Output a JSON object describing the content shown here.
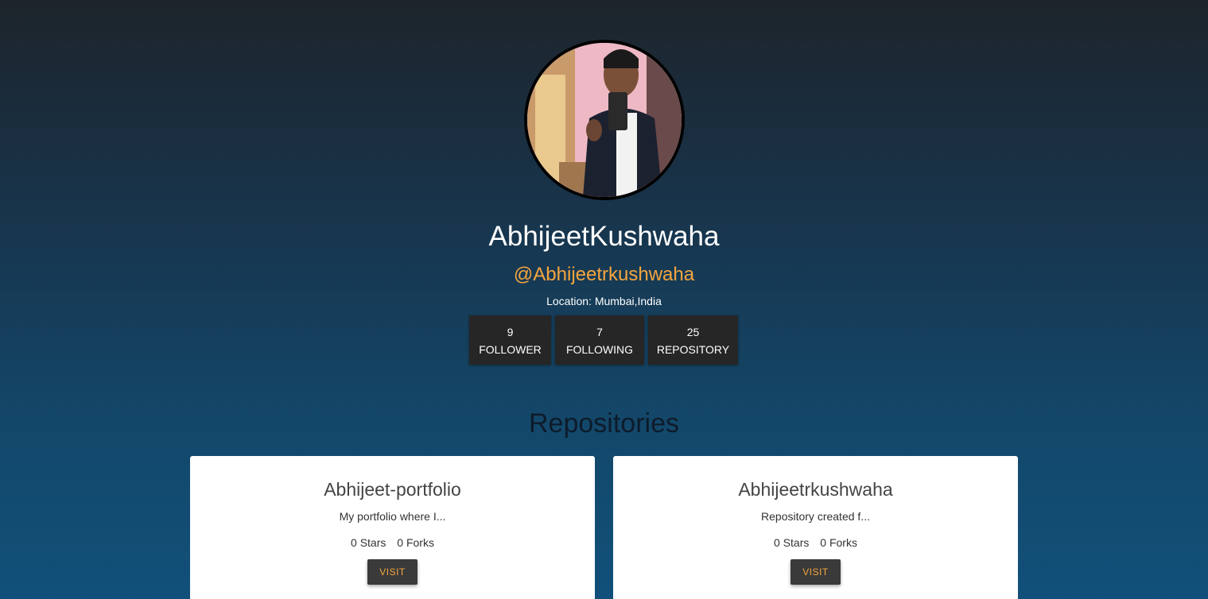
{
  "profile": {
    "avatar_alt": "profile photo",
    "display_name": "AbhijeetKushwaha",
    "username": "@Abhijeetrkushwaha",
    "location": "Location: Mumbai,India"
  },
  "stats": [
    {
      "value": "9",
      "label": "FOLLOWER"
    },
    {
      "value": "7",
      "label": "FOLLOWING"
    },
    {
      "value": "25",
      "label": "REPOSITORY"
    }
  ],
  "repositories_section": {
    "title": "Repositories"
  },
  "repositories": [
    {
      "name": "Abhijeet-portfolio",
      "description": "My portfolio where I...",
      "stars": "0 Stars",
      "forks": "0 Forks",
      "button_label": "VISIT"
    },
    {
      "name": "Abhijeetrkushwaha",
      "description": "Repository created f...",
      "stars": "0 Stars",
      "forks": "0 Forks",
      "button_label": "VISIT"
    }
  ],
  "colors": {
    "accent": "#f6a53e",
    "stat_bg": "#262626",
    "card_bg": "#ffffff",
    "button_bg": "#3a3a3a"
  }
}
